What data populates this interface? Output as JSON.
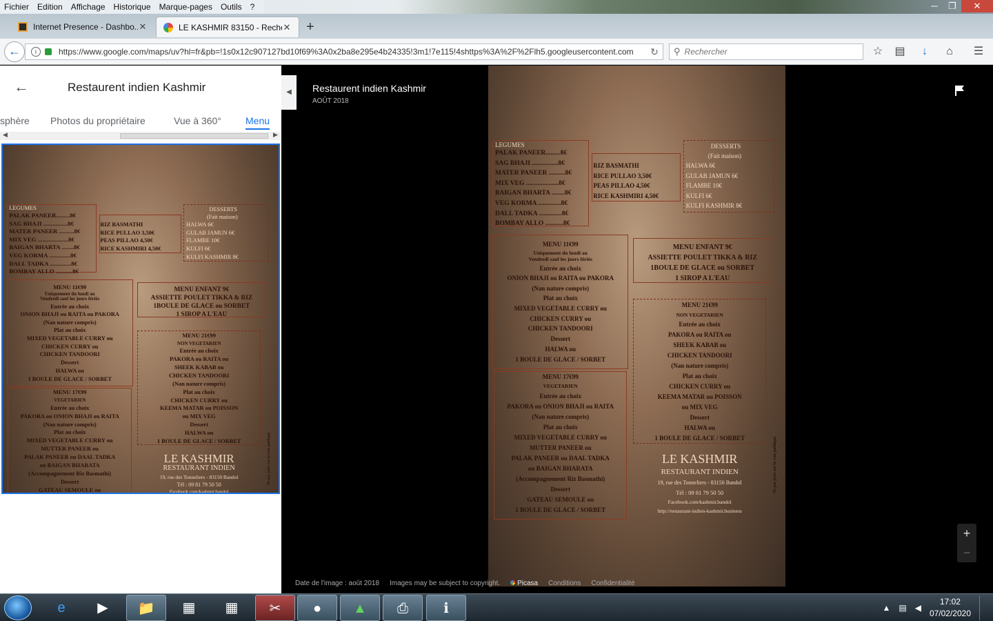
{
  "menubar": {
    "items": [
      "Fichier",
      "Edition",
      "Affichage",
      "Historique",
      "Marque-pages",
      "Outils",
      "?"
    ]
  },
  "tabs": [
    {
      "title": "Internet Presence - Dashbo..."
    },
    {
      "title": "LE KASHMIR 83150 - Reche..."
    }
  ],
  "navbar": {
    "url": "https://www.google.com/maps/uv?hl=fr&pb=!1s0x12c907127bd10f69%3A0x2ba8e295e4b24335!3m1!7e115!4shttps%3A%2F%2Flh5.googleusercontent.com",
    "search_placeholder": "Rechercher"
  },
  "left_panel": {
    "title": "Restaurent indien Kashmir",
    "tabs": [
      "sphère",
      "Photos du propriétaire",
      "Vue à 360°",
      "Menu"
    ],
    "active_tab": "Menu"
  },
  "viewer": {
    "title": "Restaurent indien Kashmir",
    "date": "AOÛT 2018",
    "footer": {
      "image_date": "Date de l'image : août 2018",
      "copyright": "Images may be subject to copyright.",
      "picasa": "Picasa",
      "conditions": "Conditions",
      "privacy": "Confidentialité"
    },
    "zoom_in": "+",
    "zoom_out": "−"
  },
  "menu_card": {
    "legumes_header": "LEGUMES",
    "legumes": [
      "PALAK PANEER.........8€",
      "SAG BHAJI ................8€",
      "MATER PANEER ..........8€",
      "MIX VEG ....................8€",
      "BAIGAN BHARTA ........8€",
      "VEG KORMA ..............8€",
      "DALL TADKA ..............8€",
      "BOMBAY ALLO ...........8€"
    ],
    "riz": [
      "RIZ BASMATHI",
      "RICE PULLAO          3,50€",
      "PEAS PILLAO           4,50€",
      "RICE KASHMIRI        4,50€"
    ],
    "desserts_header": "DESSERTS",
    "desserts_sub": "(Fait maison)",
    "desserts": [
      "HALWA                   6€",
      "GULAB JAMUN          6€",
      "FLAMBE                 10€",
      "KULFI                      6€",
      "KULFI KASHMIR        8€"
    ],
    "menu1": [
      "MENU 11€99",
      "Uniquement du lundi au",
      "Vendredi sauf les jours fériés",
      "Entrée au choix",
      "ONION BHAJI ou RAITA ou PAKORA",
      "(Nan nature compris)",
      "Plat au choix",
      "MIXED VEGETABLE CURRY ou",
      "CHICKEN CURRY ou",
      "CHICKEN TANDOORI",
      "Dessert",
      "HALWA ou",
      "1 BOULE DE GLACE / SORBET"
    ],
    "enfant": [
      "MENU ENFANT 9€",
      "ASSIETTE POULET TIKKA & RIZ",
      "1BOULE DE GLACE ou SORBET",
      "1 SIROP A L'EAU"
    ],
    "menu2": [
      "MENU 21€99",
      "NON VEGETARIEN",
      "Entrée au choix",
      "PAKORA ou RAITA ou",
      "SHEEK KABAB ou",
      "CHICKEN TANDOORI",
      "(Nan nature compris)",
      "Plat au choix",
      "CHICKEN CURRY ou",
      "KEEMA MATAR ou POISSON",
      "ou MIX VEG",
      "Dessert",
      "HALWA ou",
      "1 BOULE DE GLACE / SORBET"
    ],
    "menu3": [
      "MENU 17€99",
      "VEGETARIEN",
      "Entrée au choix",
      "PAKORA ou ONION BHAJI ou RAITA",
      "(Nan nature compris)",
      "Plat au choix",
      "MIXED VEGETABLE CURRY ou",
      "MUTTER PANEER ou",
      "PALAK PANEER ou DAAL TADKA",
      "ou BAIGAN BHARATA",
      "(Accompagnement Riz Basmathi)",
      "Dessert",
      "GATEAU SEMOULE ou",
      "1 BOULE DE GLACE / SORBET"
    ],
    "brand": "LE KASHMIR",
    "brand_sub": "RESTAURANT INDIEN",
    "address": "19, rue des Tonneliers - 83150 Bandol",
    "tel": "Tél : 09 81 79 50 50",
    "facebook": "Facebook.com/kashmir.bandol",
    "web": "http://restaurant-indien-kashmir.business",
    "side_note": "Ne pas jeter sur la voie publique"
  },
  "taskbar": {
    "time": "17:02",
    "date": "07/02/2020"
  }
}
